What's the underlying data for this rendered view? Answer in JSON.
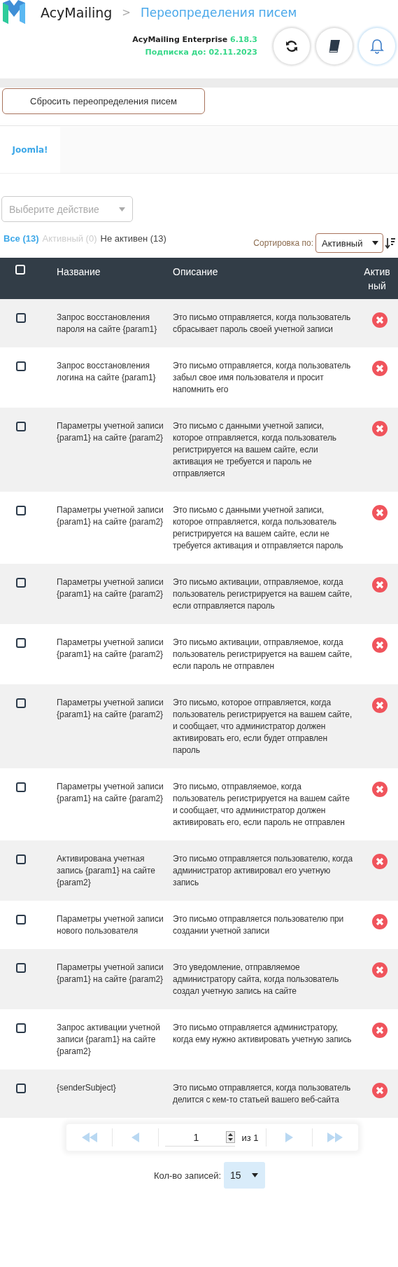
{
  "header": {
    "app": "AcyMailing",
    "separator": ">",
    "page_title": "Переопределения писем",
    "edition": "AcyMailing Enterprise",
    "version": "6.18.3",
    "subscription": "Подписка до: 02.11.2023"
  },
  "reset_button": "Сбросить переопределения писем",
  "tabs": [
    {
      "label": "Joomla!",
      "selected": true
    }
  ],
  "action_select": {
    "placeholder": "Выберите действие"
  },
  "filters": [
    {
      "label": "Все",
      "count": "(13)",
      "selected": true,
      "disabled": false
    },
    {
      "label": "Активный",
      "count": "(0)",
      "selected": false,
      "disabled": true
    },
    {
      "label": "Не активен",
      "count": "(13)",
      "selected": false,
      "disabled": false
    }
  ],
  "sort": {
    "label": "Сортировка по:",
    "value": "Активный"
  },
  "table": {
    "columns": [
      "Название",
      "Описание",
      "Активный"
    ],
    "header_checked": false,
    "rows": [
      {
        "name": "Запрос восстановления пароля на сайте {param1}",
        "description": "Это письмо отправляется, когда пользователь сбрасывает пароль своей учетной записи",
        "checked": false,
        "active": false
      },
      {
        "name": "Запрос восстановления логина на сайте {param1}",
        "description": "Это письмо отправляется, когда пользователь забыл свое имя пользователя и просит напомнить его",
        "checked": false,
        "active": false
      },
      {
        "name": "Параметры учетной записи {param1} на сайте {param2}",
        "description": "Это письмо с данными учетной записи, которое отправляется, когда пользователь регистрируется на вашем сайте, если активация не требуется и пароль не отправляется",
        "checked": false,
        "active": false
      },
      {
        "name": "Параметры учетной записи {param1} на сайте {param2}",
        "description": "Это письмо с данными учетной записи, которое отправляется, когда пользователь регистрируется на вашем сайте, если не требуется активация и отправляется пароль",
        "checked": false,
        "active": false
      },
      {
        "name": "Параметры учетной записи {param1} на сайте {param2}",
        "description": "Это письмо активации, отправляемое, когда пользователь регистрируется на вашем сайте, если отправляется пароль",
        "checked": false,
        "active": false
      },
      {
        "name": "Параметры учетной записи {param1} на сайте {param2}",
        "description": "Это письмо активации, отправляемое, когда пользователь регистрируется на вашем сайте, если пароль не отправлен",
        "checked": false,
        "active": false
      },
      {
        "name": "Параметры учетной записи {param1} на сайте {param2}",
        "description": "Это письмо, которое отправляется, когда пользователь регистрируется на вашем сайте, и сообщает, что администратор должен активировать его, если будет отправлен пароль",
        "checked": false,
        "active": false
      },
      {
        "name": "Параметры учетной записи {param1} на сайте {param2}",
        "description": "Это письмо, отправляемое, когда пользователь регистрируется на вашем сайте и сообщает, что администратор должен активировать его, если пароль не отправлен",
        "checked": false,
        "active": false
      },
      {
        "name": "Активирована учетная запись {param1} на сайте {param2}",
        "description": "Это письмо отправляется пользователю, когда администратор активировал его учетную запись",
        "checked": false,
        "active": false
      },
      {
        "name": "Параметры учетной записи нового пользователя",
        "description": "Это письмо отправляется пользователю при создании учетной записи",
        "checked": false,
        "active": false
      },
      {
        "name": "Параметры учетной записи {param1} на сайте {param2}",
        "description": "Это уведомление, отправляемое администратору сайта, когда пользователь создал учетную запись на сайте",
        "checked": false,
        "active": false
      },
      {
        "name": "Запрос активации учетной записи {param1} на сайте {param2}",
        "description": "Это письмо отправляется администратору, когда ему нужно активировать учетную запись",
        "checked": false,
        "active": false
      },
      {
        "name": "{senderSubject}",
        "description": "Это письмо отправляется, когда пользователь делится с кем-то статьей вашего веб-сайта",
        "checked": false,
        "active": false
      }
    ]
  },
  "pagination": {
    "page": "1",
    "of": "из 1",
    "per_page_label": "Кол-во записей:",
    "per_page": "15"
  }
}
